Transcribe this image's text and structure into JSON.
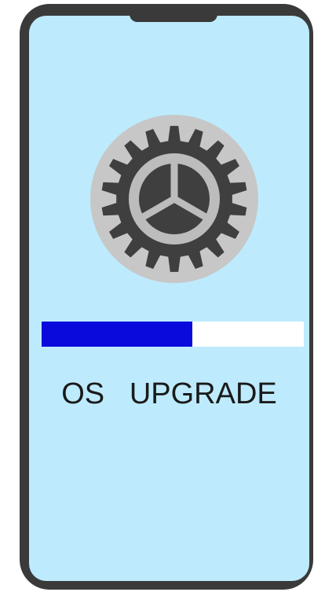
{
  "screen": {
    "title_word_1": "OS",
    "title_word_2": "UPGRADE",
    "progress": {
      "fraction": 0.575,
      "fill_color": "#0a0adc",
      "track_color": "#ffffff"
    },
    "icon": "gear-icon",
    "background_color": "#bdebfd"
  },
  "device": {
    "frame_color": "#3a3a3a"
  }
}
